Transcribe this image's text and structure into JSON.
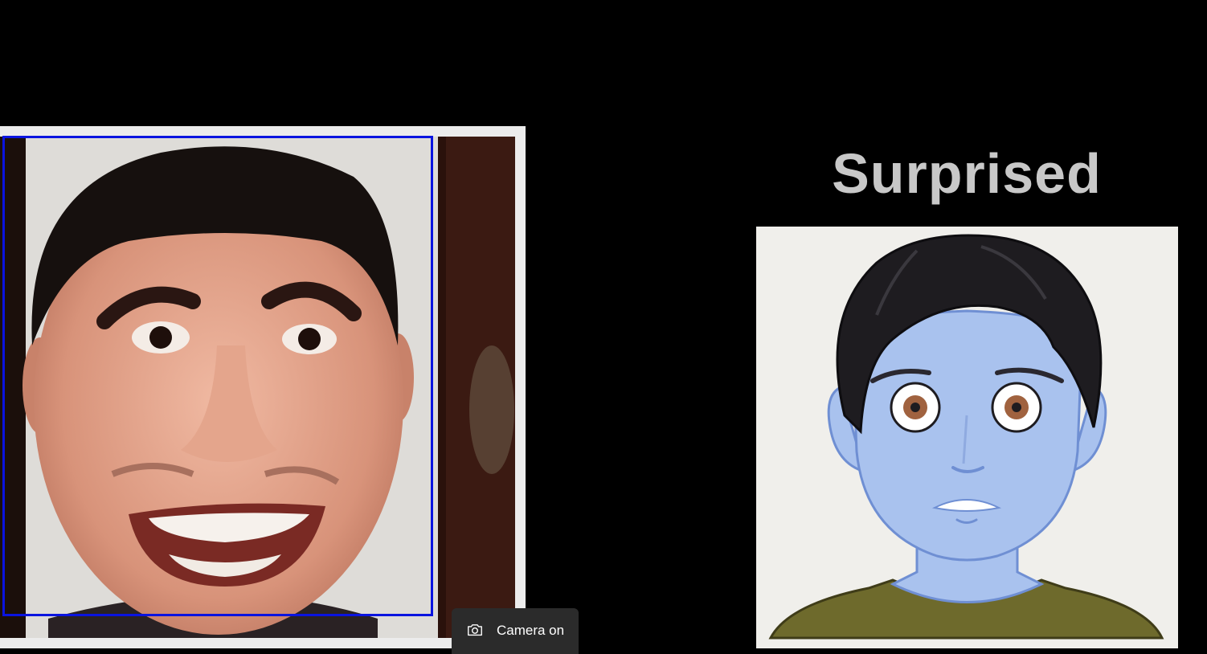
{
  "webcam": {
    "face_box_color": "#0a14e0"
  },
  "emotion": {
    "label": "Surprised"
  },
  "avatar": {
    "skin_color": "#a9c2ee",
    "hair_color": "#1e1c20",
    "shirt_color": "#6e6a2c",
    "background_color": "#f0efeb"
  },
  "toast": {
    "icon": "camera-icon",
    "text": "Camera on",
    "background_color": "#2b2b2b"
  }
}
